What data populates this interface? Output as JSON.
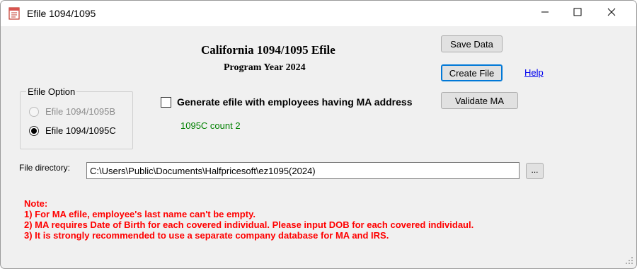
{
  "window": {
    "title": "Efile 1094/1095",
    "icons": [
      "app-form-icon",
      "minimize-icon",
      "maximize-icon",
      "close-icon",
      "resize-grip-icon"
    ]
  },
  "header": {
    "title": "California 1094/1095 Efile",
    "subtitle": "Program Year 2024"
  },
  "buttons": {
    "save": "Save Data",
    "create": "Create File",
    "validate": "Validate MA",
    "browse": "..."
  },
  "help_link": "Help",
  "efile_option": {
    "legend": "Efile Option",
    "options": [
      {
        "label": "Efile 1094/1095B",
        "selected": false,
        "enabled": false
      },
      {
        "label": "Efile 1094/1095C",
        "selected": true,
        "enabled": true
      }
    ]
  },
  "ma_checkbox": {
    "label": "Generate efile with employees having MA address",
    "checked": false
  },
  "count_text": "1095C count 2",
  "file_directory": {
    "label": "File directory:",
    "value": "C:\\Users\\Public\\Documents\\Halfpricesoft\\ez1095(2024)"
  },
  "notes": [
    "Note:",
    "1) For MA efile, employee's last name can't be empty.",
    "2) MA requires Date of Birth for each covered individual. Please input DOB for each covered individaul.",
    "3) It is strongly recommended to use a separate company database for MA and IRS."
  ],
  "colors": {
    "note_text": "#ff0000",
    "count_text": "#008000",
    "link": "#0000ee",
    "focus_border": "#0078d7"
  }
}
